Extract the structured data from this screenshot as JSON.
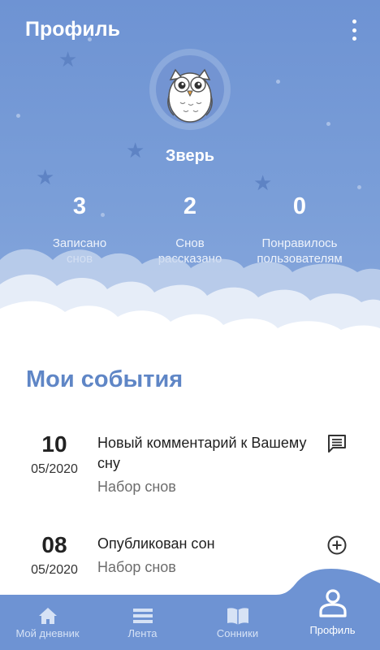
{
  "header": {
    "title": "Профиль",
    "menu_icon": "more-vertical-icon"
  },
  "profile": {
    "username": "Зверь",
    "avatar_icon": "owl-avatar-icon"
  },
  "stats": [
    {
      "value": "3",
      "label_line1": "Записано",
      "label_line2": "снов"
    },
    {
      "value": "2",
      "label_line1": "Снов",
      "label_line2": "рассказано"
    },
    {
      "value": "0",
      "label_line1": "Понравилось",
      "label_line2": "пользователям"
    }
  ],
  "events_section": {
    "title": "Мои события",
    "items": [
      {
        "day": "10",
        "month": "05/2020",
        "title": "Новый комментарий к Вашему сну",
        "subtitle": "Набор снов",
        "icon": "comment-icon"
      },
      {
        "day": "08",
        "month": "05/2020",
        "title": "Опубликован сон",
        "subtitle": "Набор снов",
        "icon": "plus-circle-icon"
      }
    ]
  },
  "bottom_nav": {
    "items": [
      {
        "label": "Мой дневник",
        "icon": "home-icon"
      },
      {
        "label": "Лента",
        "icon": "feed-icon"
      },
      {
        "label": "Сонники",
        "icon": "book-icon"
      },
      {
        "label": "Профиль",
        "icon": "user-icon"
      }
    ],
    "active_index": 3
  },
  "colors": {
    "header_bg": "#6e93d3",
    "accent": "#5f86c6",
    "nav_bg": "#6e93d3"
  }
}
